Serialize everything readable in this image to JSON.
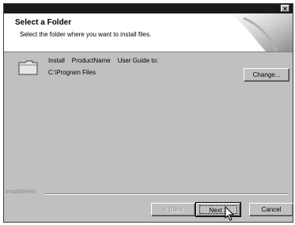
{
  "window": {
    "close_label": "×"
  },
  "header": {
    "title": "Select a Folder",
    "subtitle": "Select the folder where you want to install files."
  },
  "main": {
    "install_line": "Install    ProductName    User Guide to:",
    "path": "C:\\Program Files",
    "change_label": "Change..."
  },
  "footer": {
    "brand": "InstallShield",
    "back_label": "< Back",
    "next_label": "Next >",
    "cancel_label": "Cancel"
  },
  "icons": [
    "folder-icon",
    "close-icon",
    "cursor-icon"
  ]
}
